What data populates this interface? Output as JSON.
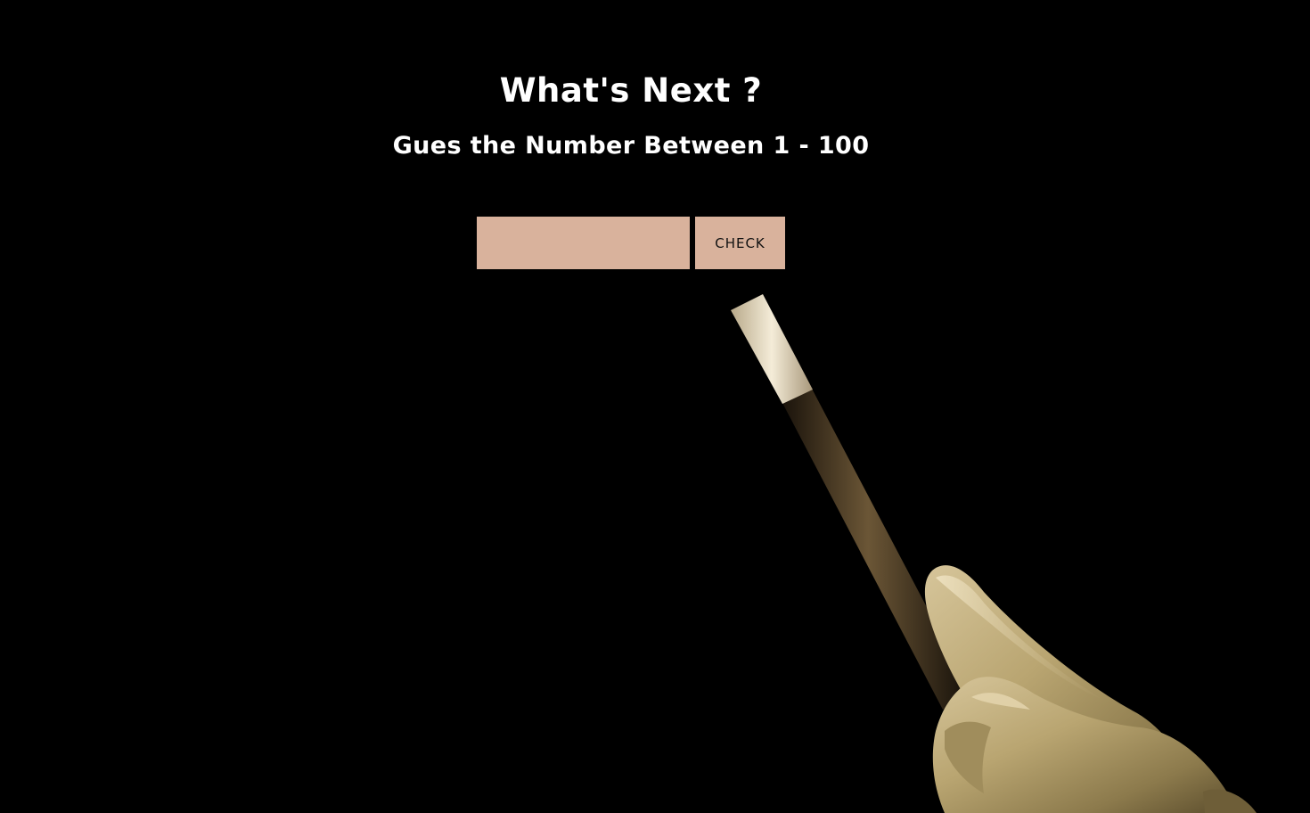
{
  "game": {
    "title": "What's Next ?",
    "subtitle": "Gues the Number Between 1 - 100",
    "guess_input": {
      "value": "",
      "placeholder": ""
    },
    "check_label": "CHECK"
  },
  "colors": {
    "background": "#000000",
    "heading_text": "#ffffff",
    "control_fill": "#d9b29c",
    "button_text": "#111111"
  },
  "decoration": {
    "illustration": "magic-wand-in-gloved-hand"
  }
}
